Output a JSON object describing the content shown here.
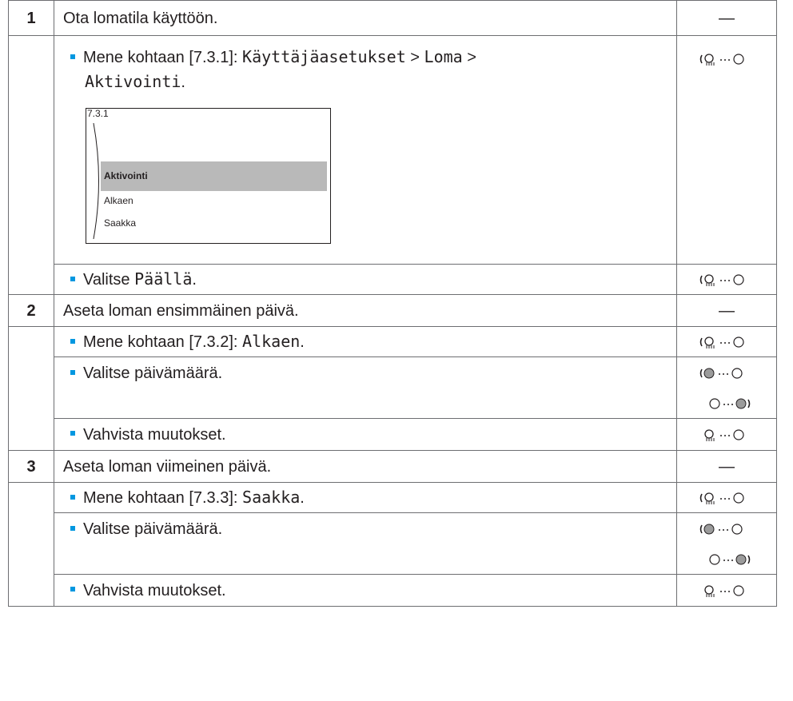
{
  "rows": [
    {
      "num": "1",
      "text": "Ota lomatila käyttöön.",
      "icon": "dash"
    },
    {
      "prefix": "Mene kohtaan [7.3.1]:",
      "path": [
        "Käyttäjäasetukset",
        "Loma",
        "Aktivointi"
      ],
      "sep": ">",
      "icon": "rotate-dial-left-icon"
    },
    {
      "text_prefix": "Valitse",
      "text_mono": "Päällä",
      "icon": "rotate-dial-left-icon"
    },
    {
      "num": "2",
      "text": "Aseta loman ensimmäinen päivä.",
      "icon": "dash"
    },
    {
      "prefix": "Mene kohtaan [7.3.2]:",
      "mono": "Alkaen",
      "icon": "rotate-dial-left-icon"
    },
    {
      "text": "Valitse päivämäärä.",
      "icons": [
        "turn-left-dial-icon",
        "turn-right-dial-icon"
      ]
    },
    {
      "text": "Vahvista muutokset.",
      "icon": "press-dial-left-icon"
    },
    {
      "num": "3",
      "text": "Aseta loman viimeinen päivä.",
      "icon": "dash"
    },
    {
      "prefix": "Mene kohtaan [7.3.3]:",
      "mono": "Saakka",
      "icon": "rotate-dial-left-icon"
    },
    {
      "text": "Valitse päivämäärä.",
      "icons": [
        "turn-left-dial-icon",
        "turn-right-dial-icon"
      ]
    },
    {
      "text": "Vahvista muutokset.",
      "icon": "press-dial-left-icon"
    }
  ],
  "dash_symbol": "—",
  "screen": {
    "code": "7.3.1",
    "items": [
      "Aktivointi",
      "Alkaen",
      "Saakka"
    ],
    "selected": "Aktivointi"
  }
}
